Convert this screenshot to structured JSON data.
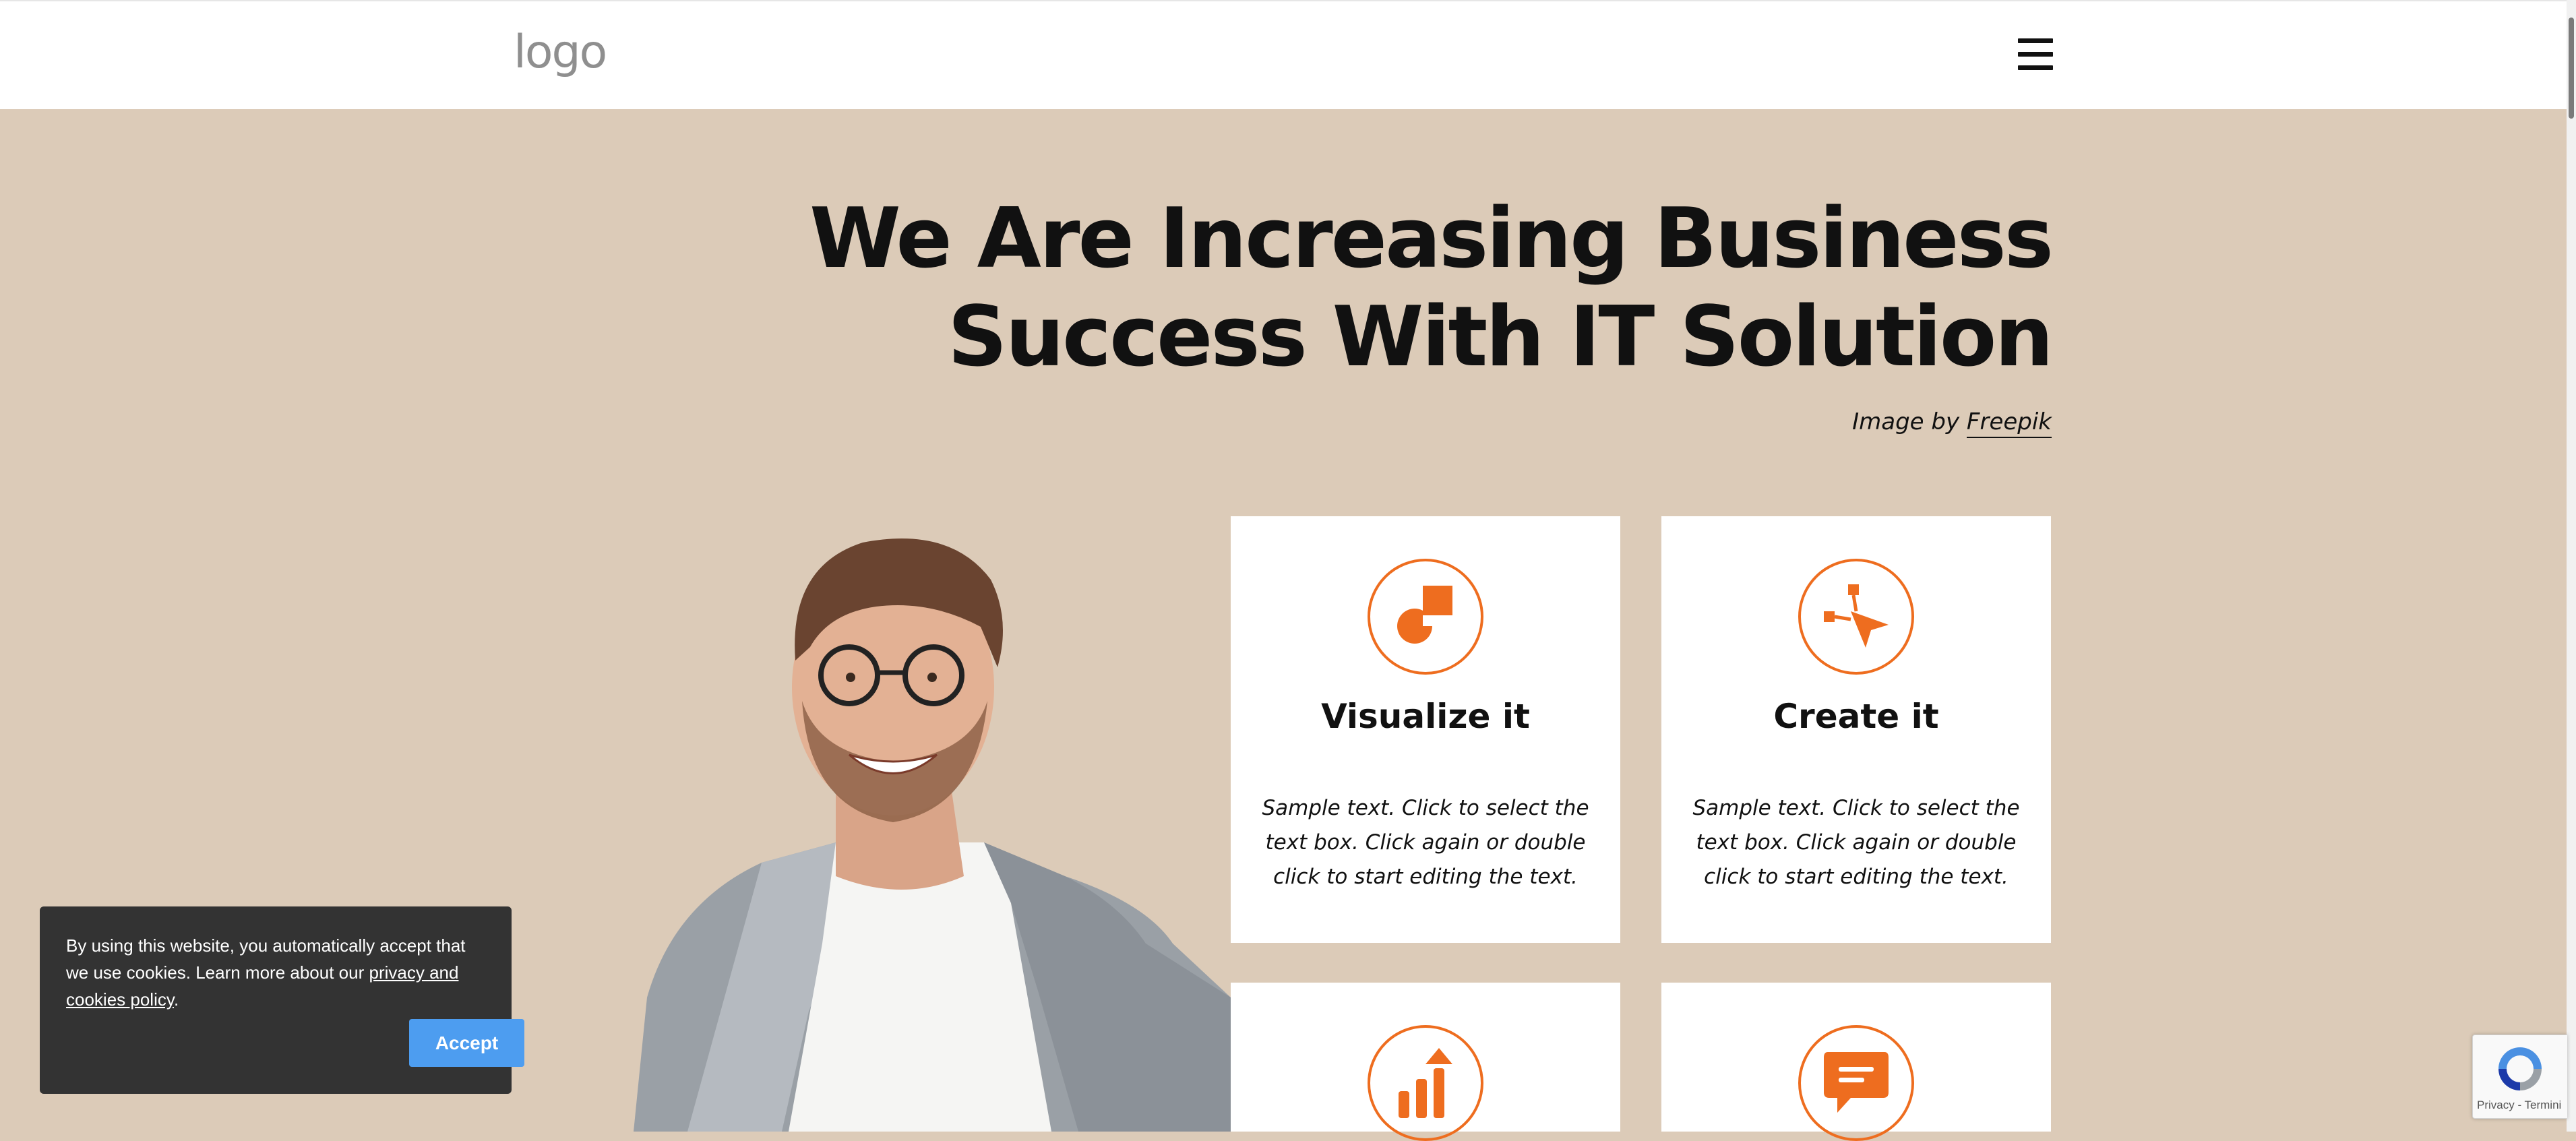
{
  "header": {
    "logo_text": "logo",
    "menu_icon": "hamburger-menu-icon"
  },
  "hero": {
    "title_line1": "We Are Increasing Business",
    "title_line2": "Success With IT Solution",
    "credit_prefix": "Image by ",
    "credit_link": "Freepik"
  },
  "cards": [
    {
      "title": "Visualize it",
      "text": "Sample text. Click to select the text box. Click again or double click to start editing the text.",
      "icon": "shapes-icon"
    },
    {
      "title": "Create it",
      "text": "Sample text. Click to select the text box. Click again or double click to start editing the text.",
      "icon": "vector-pointer-icon"
    },
    {
      "title": "",
      "text": "",
      "icon": "bar-chart-growth-icon"
    },
    {
      "title": "",
      "text": "",
      "icon": "chat-bubble-icon"
    }
  ],
  "cookie_banner": {
    "message_start": "By using this website, you automatically accept that we use cookies. Learn more about our ",
    "policy_link": "privacy and cookies policy",
    "message_end": ".",
    "accept_label": "Accept"
  },
  "recaptcha": {
    "footer_text": "Privacy - Termini"
  },
  "colors": {
    "background": "#dccbb8",
    "accent": "#ee6d1f",
    "cookie_bg": "#333333",
    "accept_button": "#4d9df0"
  }
}
